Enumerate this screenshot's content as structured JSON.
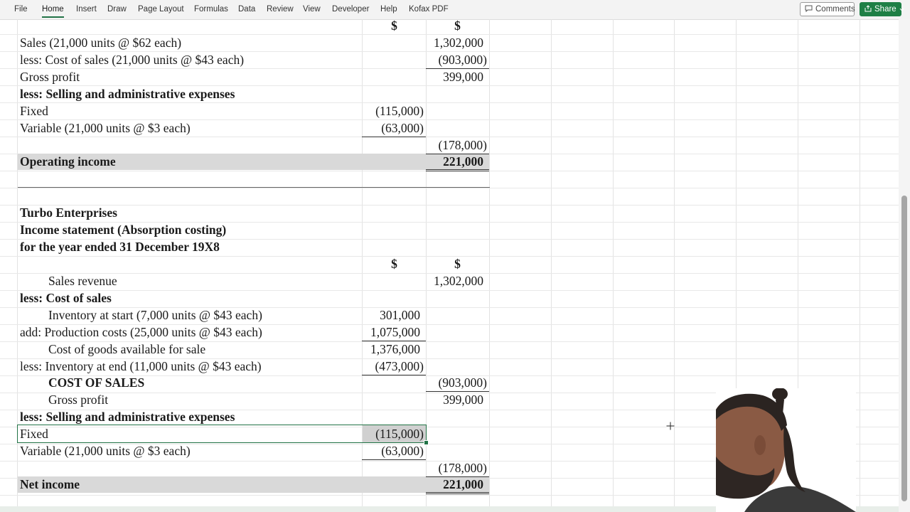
{
  "menu": {
    "file": "File",
    "home": "Home",
    "insert": "Insert",
    "draw": "Draw",
    "page_layout": "Page Layout",
    "formulas": "Formulas",
    "data": "Data",
    "review": "Review",
    "view": "View",
    "developer": "Developer",
    "help": "Help",
    "kofax": "Kofax PDF"
  },
  "toolbar": {
    "comments_label": "Comments",
    "share_label": "Share",
    "comments_icon": "comment-icon",
    "share_icon": "share-icon",
    "share_chevron": "chevron-down-icon"
  },
  "colors": {
    "accent": "#217346",
    "share_button": "#1e7f45",
    "shaded_row": "#d9d9d9",
    "selected_fill": "#d0d0d0"
  },
  "sheet": {
    "top": {
      "head_b": "$",
      "head_c": "$",
      "sales_label": "Sales (21,000 units @ $62 each)",
      "sales_value": "1,302,000",
      "cos_label": "less: Cost of sales (21,000 units @ $43 each)",
      "cos_value": "(903,000)",
      "gp_label": "Gross profit",
      "gp_value": "399,000",
      "sae_label": "less: Selling and administrative expenses",
      "fixed_label": "Fixed",
      "fixed_value": "(115,000)",
      "var_label": "Variable (21,000 units @ $3 each)",
      "var_value": "(63,000)",
      "sae_total": "(178,000)",
      "oi_label": "Operating income",
      "oi_value": "221,000"
    },
    "bottom": {
      "company": "Turbo Enterprises",
      "statement": "Income statement (Absorption costing)",
      "period": "for the year ended 31 December 19X8",
      "head_b": "$",
      "head_c": "$",
      "sales_label": "Sales revenue",
      "sales_value": "1,302,000",
      "cos_label": "less: Cost of sales",
      "inv_start_label": "Inventory at start (7,000 units @ $43 each)",
      "inv_start_value": "301,000",
      "prod_label": "add: Production costs (25,000 units @ $43 each)",
      "prod_value": "1,075,000",
      "cogas_label": "Cost of goods available for sale",
      "cogas_value": "1,376,000",
      "inv_end_label": "less: Inventory at end (11,000 units @ $43 each)",
      "inv_end_value": "(473,000)",
      "cos_total_label": "COST OF SALES",
      "cos_total_value": "(903,000)",
      "gp_label": "Gross profit",
      "gp_value": "399,000",
      "sae_label": "less: Selling and administrative expenses",
      "fixed_label": "Fixed",
      "fixed_value": "(115,000)",
      "var_label": "Variable (21,000 units @ $3 each)",
      "var_value": "(63,000)",
      "sae_total": "(178,000)",
      "ni_label": "Net income",
      "ni_value": "221,000"
    }
  }
}
